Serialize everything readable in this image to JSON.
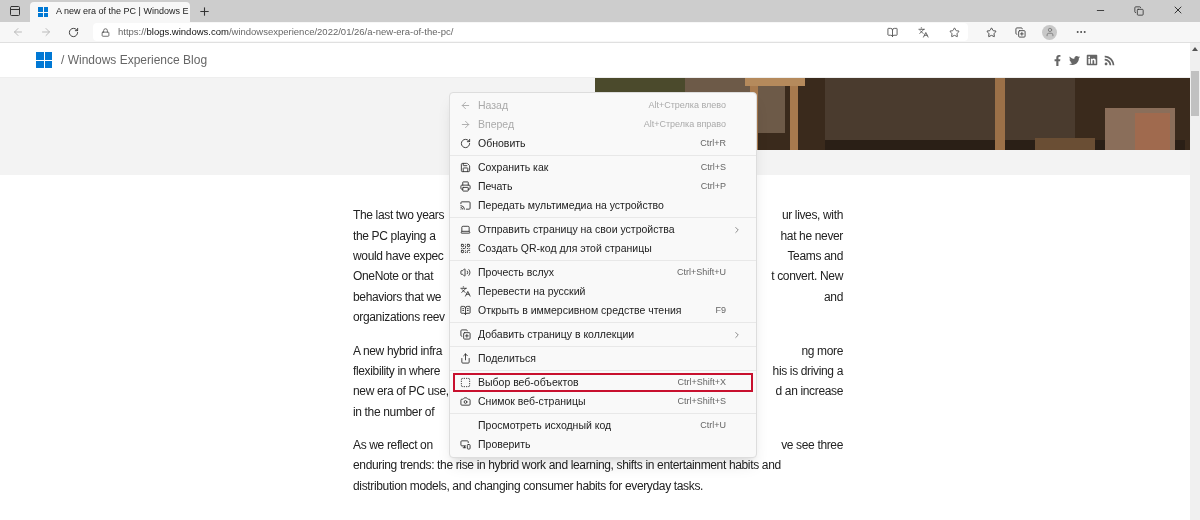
{
  "browser": {
    "tab": {
      "title": "A new era of the PC | Windows E",
      "selected": true
    },
    "address": {
      "url_start": "https://",
      "url_host": "blogs.windows.com",
      "url_path": "/windowsexperience/2022/01/26/a-new-era-of-the-pc/"
    }
  },
  "site_header": {
    "title": "/ Windows Experience Blog"
  },
  "article": {
    "paragraphs": [
      {
        "lines": [
          {
            "left": "The last two years",
            "right": "ur lives, with"
          },
          {
            "left": "the PC playing a",
            "right": "hat he never"
          },
          {
            "left": "would have expec",
            "right": "Teams and"
          },
          {
            "left": "OneNote or that",
            "right": "t convert. New"
          },
          {
            "left": "behaviors that we",
            "right": "and"
          },
          {
            "left": "organizations reev"
          }
        ]
      },
      {
        "lines": [
          {
            "left": "A new hybrid infra",
            "right": "ng more"
          },
          {
            "left": "flexibility in where",
            "right": "his is driving a"
          },
          {
            "left": "new era of PC use,",
            "right": "d an increase"
          },
          {
            "left": "in the number of"
          }
        ]
      },
      {
        "lines": [
          {
            "left": "As we reflect on",
            "right": "ve see three"
          },
          {
            "left": "enduring trends: the rise in hybrid work and learning, shifts in entertainment habits and"
          },
          {
            "left": "distribution models, and changing consumer habits for everyday tasks."
          }
        ]
      }
    ]
  },
  "context_menu": {
    "groups": [
      {
        "items": [
          {
            "label": "Назад",
            "shortcut": "Alt+Стрелка влево",
            "disabled": true,
            "submenu": false,
            "highlighted": false
          },
          {
            "label": "Вперед",
            "shortcut": "Alt+Стрелка вправо",
            "disabled": true,
            "submenu": false,
            "highlighted": false
          },
          {
            "label": "Обновить",
            "shortcut": "Ctrl+R",
            "disabled": false,
            "submenu": false,
            "highlighted": false
          }
        ]
      },
      {
        "items": [
          {
            "label": "Сохранить как",
            "shortcut": "Ctrl+S",
            "disabled": false,
            "submenu": false,
            "highlighted": false
          },
          {
            "label": "Печать",
            "shortcut": "Ctrl+P",
            "disabled": false,
            "submenu": false,
            "highlighted": false
          },
          {
            "label": "Передать мультимедиа на устройство",
            "disabled": false,
            "submenu": false,
            "highlighted": false
          }
        ]
      },
      {
        "items": [
          {
            "label": "Отправить страницу на свои устройства",
            "disabled": false,
            "submenu": true,
            "highlighted": false
          },
          {
            "label": "Создать QR-код для этой страницы",
            "disabled": false,
            "submenu": false,
            "highlighted": false
          }
        ]
      },
      {
        "items": [
          {
            "label": "Прочесть вслух",
            "shortcut": "Ctrl+Shift+U",
            "disabled": false,
            "submenu": false,
            "highlighted": false
          },
          {
            "label": "Перевести на русский",
            "disabled": false,
            "submenu": false,
            "highlighted": false
          },
          {
            "label": "Открыть в иммерсивном средстве чтения",
            "shortcut": "F9",
            "disabled": false,
            "submenu": false,
            "highlighted": false
          }
        ]
      },
      {
        "items": [
          {
            "label": "Добавить страницу в коллекции",
            "disabled": false,
            "submenu": true,
            "highlighted": false
          }
        ]
      },
      {
        "items": [
          {
            "label": "Поделиться",
            "disabled": false,
            "submenu": false,
            "highlighted": false
          }
        ]
      },
      {
        "items": [
          {
            "label": "Выбор веб-объектов",
            "shortcut": "Ctrl+Shift+X",
            "disabled": false,
            "submenu": false,
            "highlighted": true
          },
          {
            "label": "Снимок веб-страницы",
            "shortcut": "Ctrl+Shift+S",
            "disabled": false,
            "submenu": false,
            "highlighted": false
          }
        ]
      },
      {
        "items": [
          {
            "label": "Просмотреть исходный код",
            "shortcut": "Ctrl+U",
            "disabled": false,
            "submenu": false,
            "highlighted": false
          },
          {
            "label": "Проверить",
            "disabled": false,
            "submenu": false,
            "highlighted": false
          }
        ]
      }
    ]
  }
}
